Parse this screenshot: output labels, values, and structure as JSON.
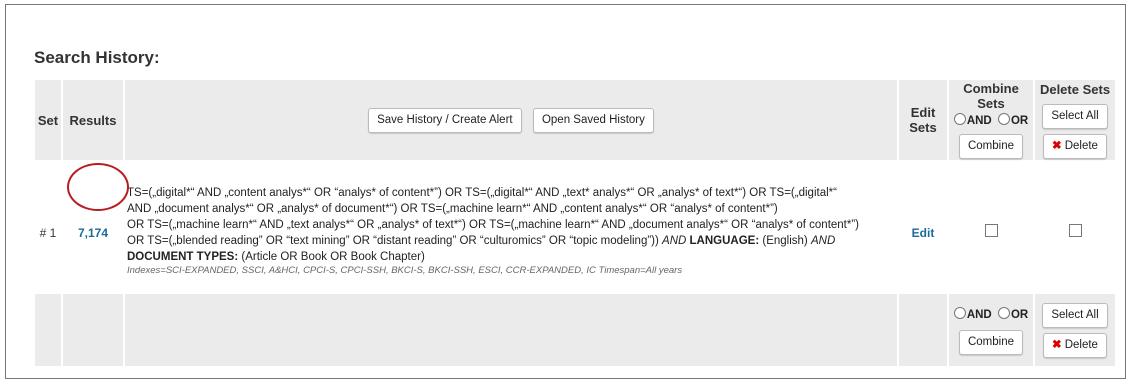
{
  "page_title": "Search History:",
  "header": {
    "set": "Set",
    "results": "Results",
    "save_history": "Save History / Create Alert",
    "open_saved": "Open Saved History",
    "edit_sets_1": "Edit",
    "edit_sets_2": "Sets",
    "combine_sets": "Combine Sets",
    "delete_sets": "Delete Sets",
    "and_label": "AND",
    "or_label": "OR",
    "combine_button": "Combine",
    "select_all": "Select All",
    "delete_button": "Delete"
  },
  "rows": [
    {
      "set": "# 1",
      "results": "7,174",
      "query_lines": [
        "TS=(„digital*“ AND „content analys*“ OR “analys* of content*”) OR TS=(„digital*“ AND „text* analys*“ OR „analys* of text*“) OR TS=(„digital*“",
        "AND „document analys*“ OR „analys* of document*“) OR TS=(„machine learn*“ AND „content analys*“ OR “analys* of content*”)",
        "OR TS=(„machine learn*“ AND „text analys*“ OR „analys* of text*“) OR TS=(„machine learn*“ AND „document analys*“ OR “analys* of content*”)",
        "OR TS=(„blended reading” OR “text mining” OR “distant reading” OR “culturomics” OR “topic modeling”))"
      ],
      "and_lang_kw": "AND",
      "language_label": "LANGUAGE:",
      "language_value": "(English)",
      "and_doc_kw": "AND",
      "doctype_label": "DOCUMENT TYPES:",
      "doctype_value": "(Article OR Book OR Book Chapter)",
      "indexes": "Indexes=SCI-EXPANDED, SSCI, A&HCI, CPCI-S, CPCI-SSH, BKCI-S, BKCI-SSH, ESCI, CCR-EXPANDED, IC Timespan=All years",
      "edit": "Edit"
    }
  ],
  "footer": {
    "and_label": "AND",
    "or_label": "OR",
    "combine_button": "Combine",
    "select_all": "Select All",
    "delete_button": "Delete"
  },
  "colors": {
    "link": "#1a6aa0",
    "delete_x": "#dd0000",
    "highlight_circle": "#b81c22",
    "header_bg": "#ebebeb"
  }
}
